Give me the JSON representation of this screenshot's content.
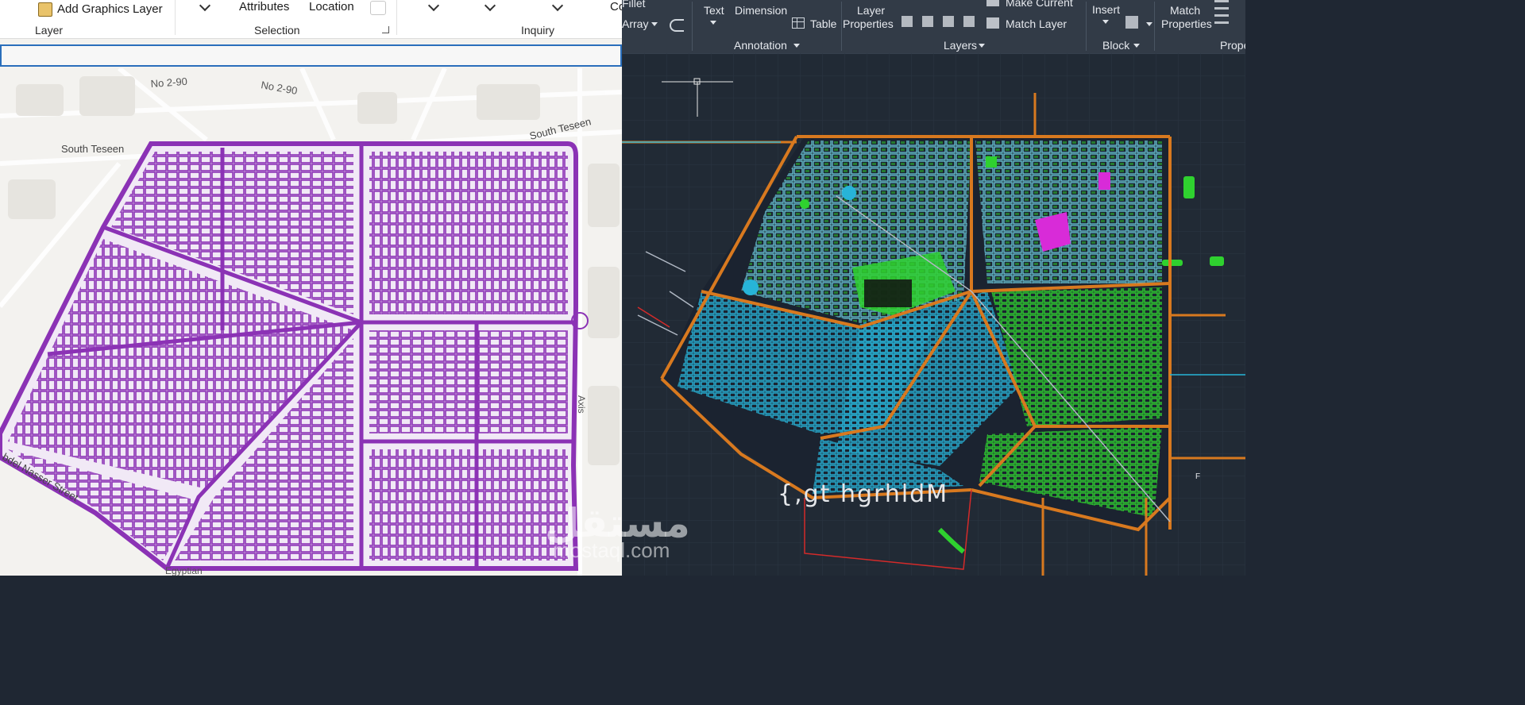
{
  "left_app": {
    "ribbon": {
      "add_graphics_layer": "Add Graphics Layer",
      "layer_group": "Layer",
      "attributes": "Attributes",
      "location": "Location",
      "selection_group": "Selection",
      "inquiry_group": "Inquiry",
      "cut_label": "Co"
    },
    "map_labels": {
      "road_1": "No 2-90",
      "road_2": "No 2-90",
      "south_teseen_left": "South Teseen",
      "south_teseen_right": "South Teseen",
      "abdel_nasser": "bdel Nasser Street",
      "axis_label": "Axis",
      "egyptian": "Egyptian"
    },
    "colors": {
      "parcels": "#8b32b5",
      "basemap": "#f3f2ef",
      "selection": "#2a6ebb"
    }
  },
  "right_app": {
    "ribbon": {
      "fillet": "Fillet",
      "array": "Array",
      "text": "Text",
      "dimension": "Dimension",
      "table": "Table",
      "annotation_group": "Annotation",
      "layer_properties_1": "Layer",
      "layer_properties_2": "Properties",
      "make_current": "Make Current",
      "match_layer": "Match Layer",
      "layers_group": "Layers",
      "insert": "Insert",
      "block_group": "Block",
      "match_properties_1": "Match",
      "match_properties_2": "Properties",
      "properties_group": "Prope"
    },
    "drawing_text": "{,gt hgrhldM",
    "label_f": "F",
    "colors": {
      "roads": "#d8791f",
      "blocks": "#27b4d8",
      "green": "#2fd12f",
      "magenta": "#d82bd8",
      "background": "#212a35"
    }
  },
  "watermark": {
    "arabic": "مستقل",
    "latin": "mostaql.com"
  }
}
